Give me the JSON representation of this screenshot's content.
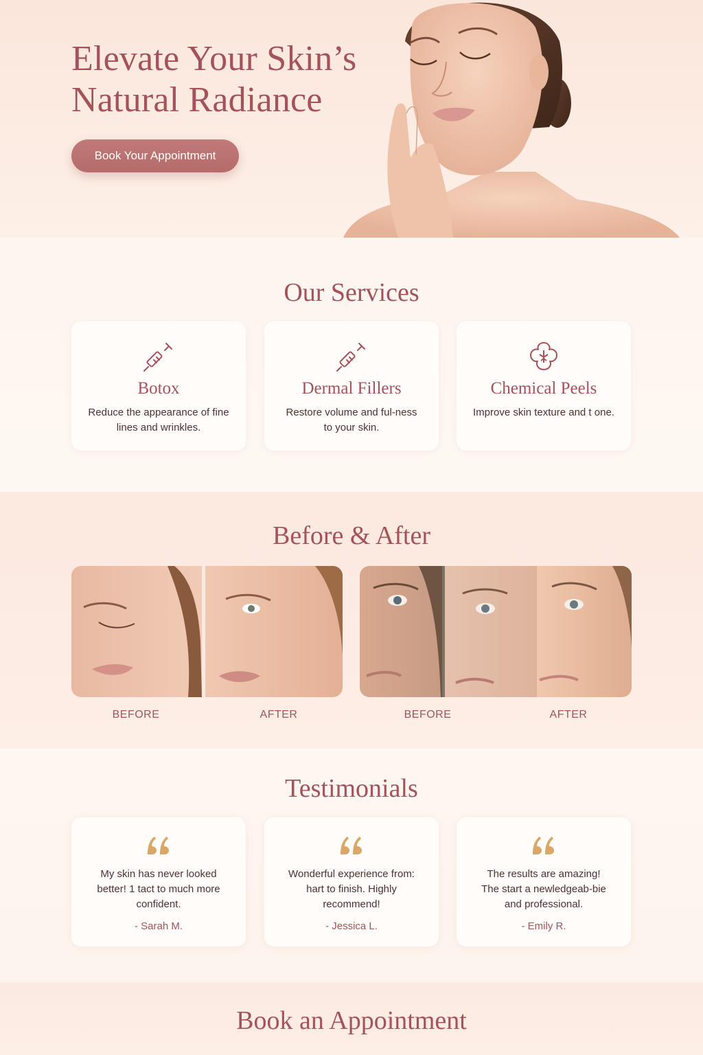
{
  "hero": {
    "title_line1": "Elevate Your Skin’s",
    "title_line2": "Natural Radiance",
    "cta_label": "Book Your Appointment"
  },
  "services": {
    "heading": "Our Services",
    "items": [
      {
        "title": "Botox",
        "description": "Reduce the appearance of fine lines and wrinkles.",
        "icon": "syringe-icon"
      },
      {
        "title": "Dermal Fillers",
        "description": "Restore volume and ful-ness to your skin.",
        "icon": "syringe-icon"
      },
      {
        "title": "Chemical Peels",
        "description": "Improve skin texture and t one.",
        "icon": "flower-icon"
      }
    ]
  },
  "before_after": {
    "heading": "Before & After",
    "labels": [
      "BEFORE",
      "AFTER",
      "BEFORE",
      "AFTER"
    ]
  },
  "testimonials": {
    "heading": "Testimonials",
    "items": [
      {
        "quote": "My skin has never looked better! 1 tact to much more confident.",
        "author": "- Sarah M."
      },
      {
        "quote": "Wonderful experience from: hart to finish. Highly recommend!",
        "author": "- Jessica L."
      },
      {
        "quote": "The results are amazing! The start a newledgeab-bie and professional.",
        "author": "- Emily R."
      }
    ]
  },
  "book": {
    "heading": "Book an Appointment"
  },
  "colors": {
    "accent": "#a4535a",
    "button": "#b56c6b",
    "quote_gold": "#d9a868",
    "page_bg": "#fdf7f2"
  }
}
